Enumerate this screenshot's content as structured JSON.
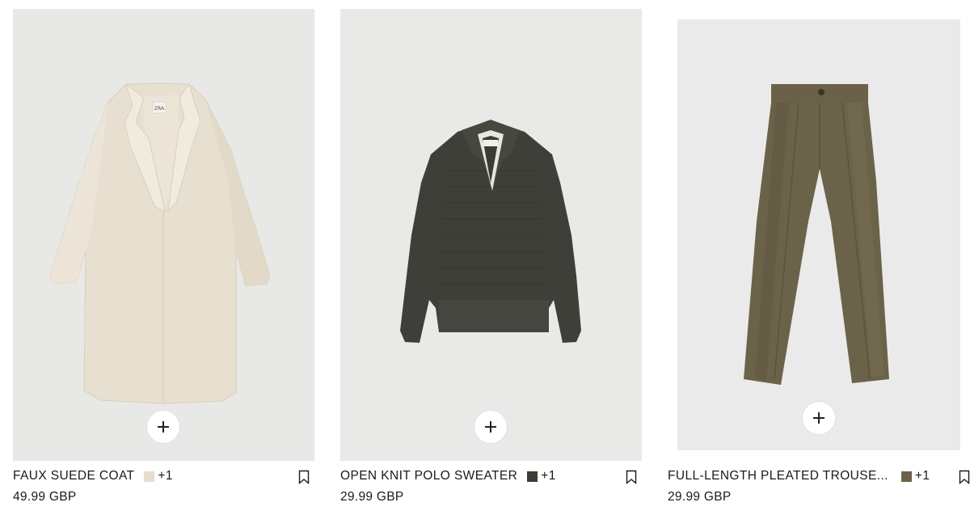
{
  "products": [
    {
      "name": "FAUX SUEDE COAT",
      "price": "49.99 GBP",
      "swatch_color": "#e5ddcd",
      "extra_colors": "+1",
      "image_icon": "coat-image"
    },
    {
      "name": "OPEN KNIT POLO SWEATER",
      "price": "29.99 GBP",
      "swatch_color": "#3b3d35",
      "extra_colors": "+1",
      "image_icon": "sweater-image"
    },
    {
      "name": "FULL-LENGTH PLEATED TROUSE...",
      "price": "29.99 GBP",
      "swatch_color": "#6c624a",
      "extra_colors": "+1",
      "image_icon": "trousers-image"
    }
  ]
}
